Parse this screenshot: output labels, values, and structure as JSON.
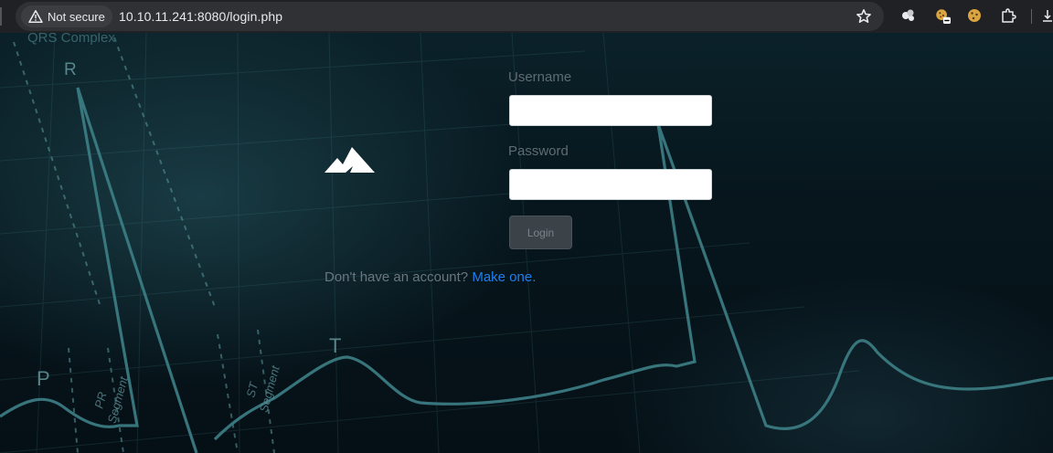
{
  "browser": {
    "security_label": "Not secure",
    "url": "10.10.11.241:8080/login.php",
    "icons": [
      "warning-icon",
      "bookmark-star-icon",
      "extension-icon",
      "extension-icon",
      "cookie-icon",
      "puzzle-icon"
    ]
  },
  "background": {
    "ecg_labels": {
      "top": "QRS Complex",
      "r": "R",
      "p": "P",
      "t": "T",
      "pr_line1": "PR",
      "pr_line2": "Segment",
      "st_line1": "ST",
      "st_line2": "Segment"
    }
  },
  "login": {
    "username_label": "Username",
    "username_value": "",
    "password_label": "Password",
    "password_value": "",
    "login_button": "Login",
    "signup_prompt": "Don't have an account?",
    "signup_link": "Make one",
    "signup_suffix": "."
  },
  "colors": {
    "background": "#06141b",
    "link": "#1d7ff0",
    "ecg_line": "#3d7f86"
  }
}
